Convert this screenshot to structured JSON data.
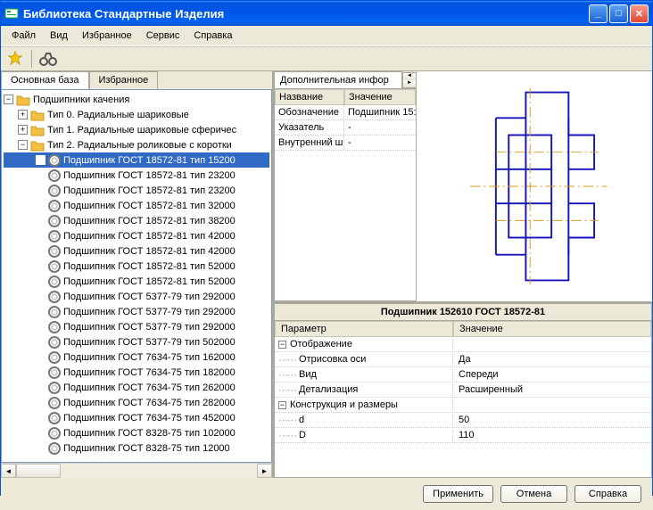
{
  "window": {
    "title": "Библиотека Стандартные Изделия"
  },
  "menu": [
    "Файл",
    "Вид",
    "Избранное",
    "Сервис",
    "Справка"
  ],
  "tabs": {
    "main": "Основная база",
    "fav": "Избранное"
  },
  "tree": {
    "root": "Подшипники качения",
    "tip0": "Тип 0. Радиальные шариковые",
    "tip1": "Тип 1. Радиальные шариковые сферичес",
    "tip2": "Тип 2. Радиальные роликовые с коротки",
    "items": [
      "Подшипник ГОСТ 18572-81 тип 15200",
      "Подшипник ГОСТ 18572-81 тип 23200",
      "Подшипник ГОСТ 18572-81 тип 23200",
      "Подшипник ГОСТ 18572-81 тип 32000",
      "Подшипник ГОСТ 18572-81 тип 38200",
      "Подшипник ГОСТ 18572-81 тип 42000",
      "Подшипник ГОСТ 18572-81 тип 42000",
      "Подшипник ГОСТ 18572-81 тип 52000",
      "Подшипник ГОСТ 18572-81 тип 52000",
      "Подшипник ГОСТ 5377-79 тип  292000",
      "Подшипник ГОСТ 5377-79 тип 292000",
      "Подшипник ГОСТ 5377-79 тип 292000",
      "Подшипник ГОСТ 5377-79 тип 502000",
      "Подшипник ГОСТ 7634-75 тип 162000",
      "Подшипник ГОСТ 7634-75 тип 182000",
      "Подшипник ГОСТ 7634-75 тип 262000",
      "Подшипник ГОСТ 7634-75 тип 282000",
      "Подшипник ГОСТ 7634-75 тип 452000",
      "Подшипник ГОСТ 8328-75 тип 102000",
      "Подшипник ГОСТ 8328-75 тип 12000"
    ]
  },
  "info": {
    "tab": "Дополнительная инфор",
    "head_name": "Название",
    "head_val": "Значение",
    "rows": [
      {
        "n": "Обозначение",
        "v": "Подшипник 15:"
      },
      {
        "n": "Указатель",
        "v": "-"
      },
      {
        "n": "Внутренний ши",
        "v": "-"
      }
    ]
  },
  "params": {
    "title": "Подшипник 152610 ГОСТ 18572-81",
    "head_p": "Параметр",
    "head_v": "Значение",
    "group1": "Отображение",
    "g1r": [
      {
        "p": "Отрисовка оси",
        "v": "Да"
      },
      {
        "p": "Вид",
        "v": "Спереди"
      },
      {
        "p": "Детализация",
        "v": "Расширенный"
      }
    ],
    "group2": "Конструкция и размеры",
    "g2r": [
      {
        "p": "d",
        "v": "50"
      },
      {
        "p": "D",
        "v": "110"
      }
    ]
  },
  "buttons": {
    "apply": "Применить",
    "cancel": "Отмена",
    "help": "Справка"
  }
}
